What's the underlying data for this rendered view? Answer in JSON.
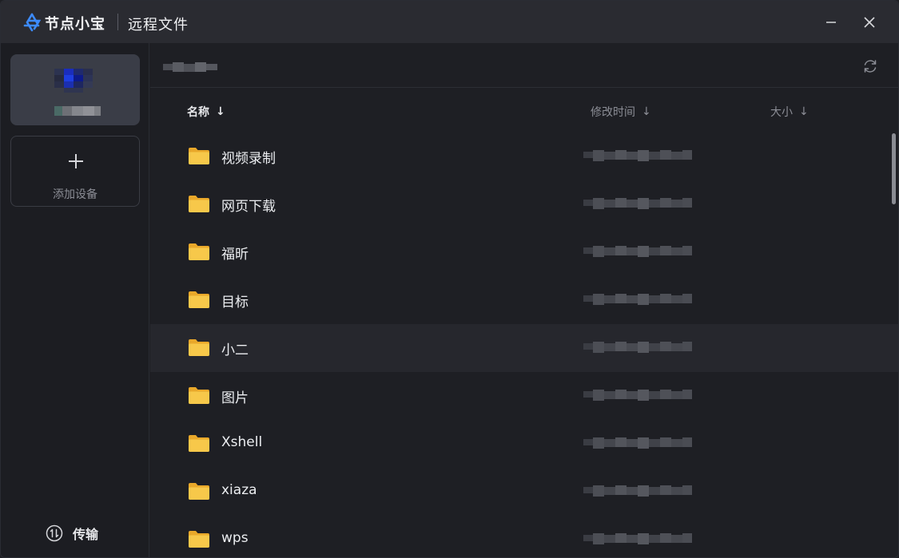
{
  "titlebar": {
    "app_name": "节点小宝",
    "window_title": "远程文件",
    "minimize_icon": "minimize-icon",
    "close_icon": "close-icon"
  },
  "sidebar": {
    "add_device_label": "添加设备",
    "transfer_label": "传输"
  },
  "columns": {
    "name": "名称",
    "mtime": "修改时间",
    "size": "大小",
    "sort_arrow": "↓"
  },
  "files": [
    {
      "name": "视频录制",
      "type": "folder"
    },
    {
      "name": "网页下载",
      "type": "folder"
    },
    {
      "name": "福昕",
      "type": "folder"
    },
    {
      "name": "目标",
      "type": "folder"
    },
    {
      "name": "小二",
      "type": "folder"
    },
    {
      "name": "图片",
      "type": "folder"
    },
    {
      "name": "Xshell",
      "type": "folder"
    },
    {
      "name": "xiaza",
      "type": "folder"
    },
    {
      "name": "wps",
      "type": "folder"
    }
  ],
  "colors": {
    "accent": "#3a7bf0",
    "folder": "#f6c343",
    "background": "#1e1f24",
    "titlebar": "#2a2b31"
  }
}
